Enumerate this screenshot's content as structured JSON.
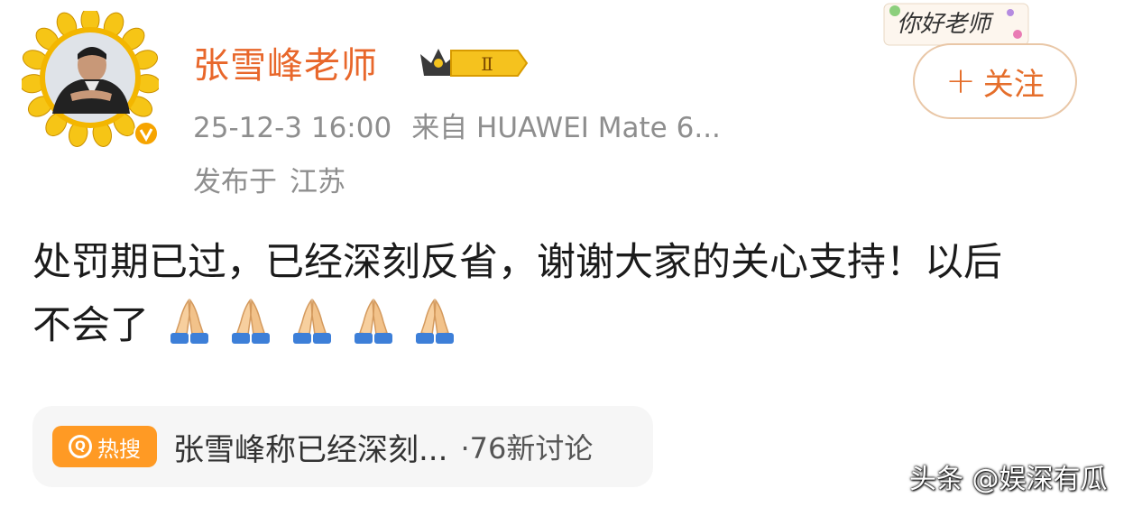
{
  "post": {
    "username": "张雪峰老师",
    "level_badge": "Ⅱ",
    "time": "25-12-3 16:00",
    "source": "来自 HUAWEI Mate 6...",
    "location_prefix": "发布于",
    "location": "江苏",
    "follow_plus": "+",
    "follow_label": "关注",
    "sticker_text": "你好老师",
    "content_text": "处罚期已过，已经深刻反省，谢谢大家的关心支持！以后不会了",
    "emoji_count": 5
  },
  "topic": {
    "badge_label": "热搜",
    "title": "张雪峰称已经深刻...",
    "count": "·76新讨论"
  },
  "watermark": "头条 @娱深有瓜",
  "colors": {
    "username": "#e8672b",
    "follow_border": "#e9c7a7",
    "meta": "#8e8e8e",
    "topic_badge": "#ff9a24"
  }
}
